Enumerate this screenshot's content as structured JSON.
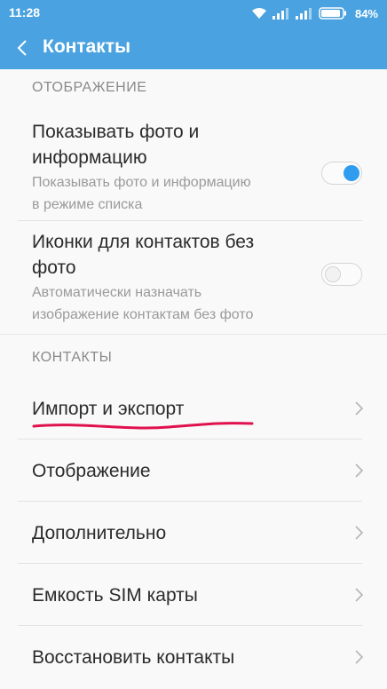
{
  "status_bar": {
    "time": "11:28",
    "battery": "84%"
  },
  "app_bar": {
    "title": "Контакты"
  },
  "section_display": {
    "header": "ОТОБРАЖЕНИЕ",
    "items": [
      {
        "title_line1": "Показывать фото и",
        "title_line2": "информацию",
        "sub_line1": "Показывать фото и информацию",
        "sub_line2": "в режиме списка",
        "toggle": "on"
      },
      {
        "title_line1": "Иконки для контактов без",
        "title_line2": "фото",
        "sub_line1": "Автоматически назначать",
        "sub_line2": "изображение контактам без фото",
        "toggle": "off"
      }
    ]
  },
  "section_contacts": {
    "header": "КОНТАКТЫ",
    "items": [
      {
        "label": "Импорт и экспорт"
      },
      {
        "label": "Отображение"
      },
      {
        "label": "Дополнительно"
      },
      {
        "label": "Емкость SIM карты"
      },
      {
        "label": "Восстановить контакты"
      }
    ]
  },
  "colors": {
    "accent": "#4aa3e0",
    "toggle_on": "#2f9cf0",
    "annotation": "#e0124e"
  }
}
